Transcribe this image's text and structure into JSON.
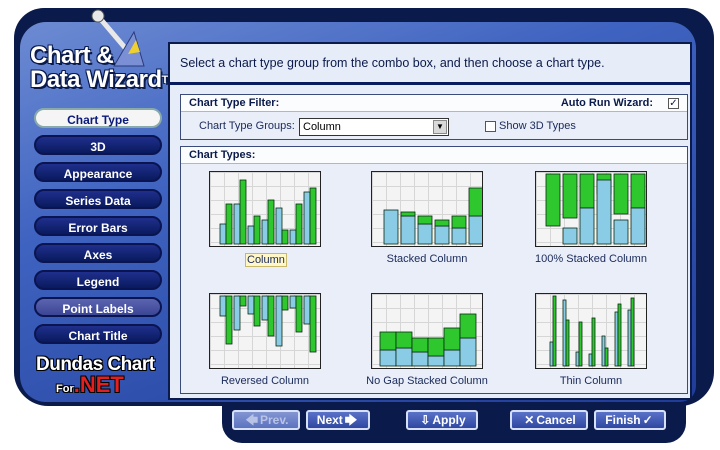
{
  "logo": {
    "line1": "Chart &",
    "line2": "Data Wizard",
    "tm": "TM"
  },
  "nav": {
    "items": [
      {
        "label": "Chart Type",
        "state": "active"
      },
      {
        "label": "3D",
        "state": "normal"
      },
      {
        "label": "Appearance",
        "state": "normal"
      },
      {
        "label": "Series Data",
        "state": "normal"
      },
      {
        "label": "Error Bars",
        "state": "normal"
      },
      {
        "label": "Axes",
        "state": "normal"
      },
      {
        "label": "Legend",
        "state": "normal"
      },
      {
        "label": "Point Labels",
        "state": "soft"
      },
      {
        "label": "Chart Title",
        "state": "normal"
      }
    ]
  },
  "brand": {
    "line1": "Dundas Chart",
    "for": "For",
    "net": ".NET"
  },
  "instructions": "Select a chart type group from the combo box, and then choose a chart type.",
  "filter": {
    "title": "Chart Type Filter:",
    "auto_run_label": "Auto Run Wizard:",
    "auto_run_checked": true,
    "groups_label": "Chart Type Groups:",
    "groups_value": "Column",
    "show3d_label": "Show 3D Types",
    "show3d_checked": false
  },
  "types": {
    "title": "Chart Types:",
    "items": [
      {
        "label": "Column",
        "selected": true,
        "icon": "column-chart-icon"
      },
      {
        "label": "Stacked Column",
        "selected": false,
        "icon": "stacked-column-chart-icon"
      },
      {
        "label": "100% Stacked Column",
        "selected": false,
        "icon": "100-stacked-column-chart-icon"
      },
      {
        "label": "Reversed Column",
        "selected": false,
        "icon": "reversed-column-chart-icon"
      },
      {
        "label": "No Gap Stacked Column",
        "selected": false,
        "icon": "no-gap-stacked-column-chart-icon"
      },
      {
        "label": "Thin Column",
        "selected": false,
        "icon": "thin-column-chart-icon"
      }
    ]
  },
  "buttons": {
    "prev": "Prev.",
    "next": "Next",
    "apply": "Apply",
    "cancel": "Cancel",
    "finish": "Finish"
  },
  "colors": {
    "green": "#2ec82e",
    "lightblue": "#8acbe6",
    "navy": "#0a1a4a"
  }
}
